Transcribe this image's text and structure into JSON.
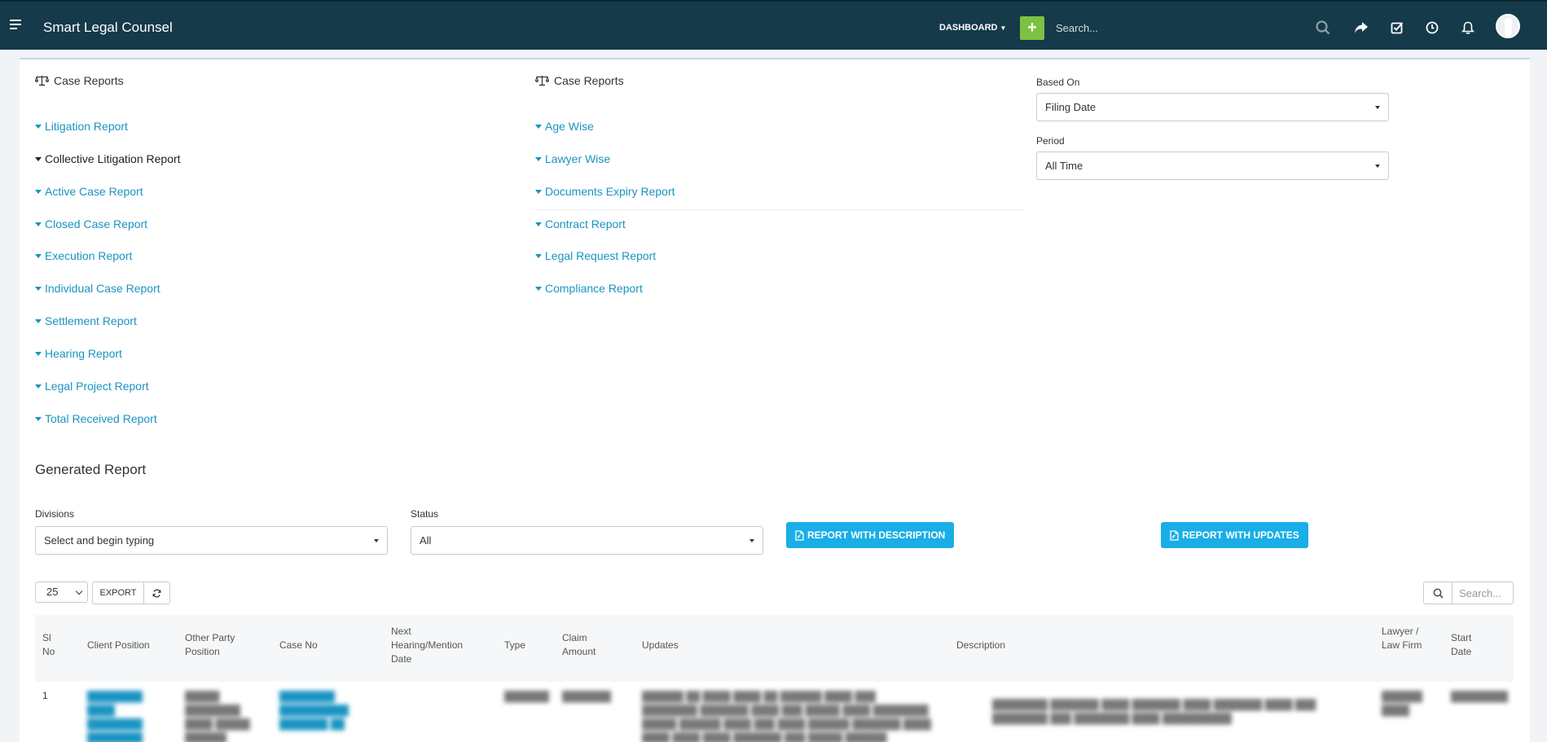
{
  "header": {
    "brand": "Smart Legal Counsel",
    "dashboard_label": "DASHBOARD",
    "add_label": "+",
    "search_placeholder": "Search...",
    "icons": [
      "search-icon",
      "share-icon",
      "tasks-icon",
      "clock-icon",
      "bell-icon",
      "avatar"
    ]
  },
  "left_column": {
    "title": "Case Reports",
    "items": [
      "Litigation Report",
      "Collective Litigation Report",
      "Active Case Report",
      "Closed Case Report",
      "Execution Report",
      "Individual Case Report",
      "Settlement Report",
      "Hearing Report",
      "Legal Project Report",
      "Total Received Report"
    ]
  },
  "middle_column": {
    "title": "Case Reports",
    "items": [
      "Age Wise",
      "Lawyer Wise",
      "Documents Expiry Report",
      "Contract Report",
      "Legal Request Report",
      "Compliance Report"
    ]
  },
  "filters": {
    "based_on_label": "Based On",
    "based_on_value": "Filing Date",
    "period_label": "Period",
    "period_value": "All Time"
  },
  "generated": {
    "title": "Generated Report",
    "divisions_label": "Divisions",
    "divisions_placeholder": "Select and begin typing",
    "status_label": "Status",
    "status_value": "All",
    "report_desc_label": "REPORT WITH DESCRIPTION",
    "report_updates_label": "REPORT WITH UPDATES"
  },
  "table": {
    "page_size": "25",
    "export_label": "EXPORT",
    "search_placeholder": "Search...",
    "columns": {
      "sl": "Sl No",
      "client_position": "Client Position",
      "other_party": "Other Party Position",
      "case_no": "Case No",
      "next_hearing": "Next Hearing/Mention Date",
      "type": "Type",
      "claim": "Claim Amount",
      "updates": "Updates",
      "description": "Description",
      "lawyer": "Lawyer / Law Firm",
      "start_date": "Start Date"
    },
    "rows": [
      {
        "sl": "1"
      }
    ]
  },
  "colors": {
    "nav_bg": "#153a4a",
    "link": "#1a93c2",
    "accent_button": "#19aee7",
    "add_button": "#7dc142"
  }
}
